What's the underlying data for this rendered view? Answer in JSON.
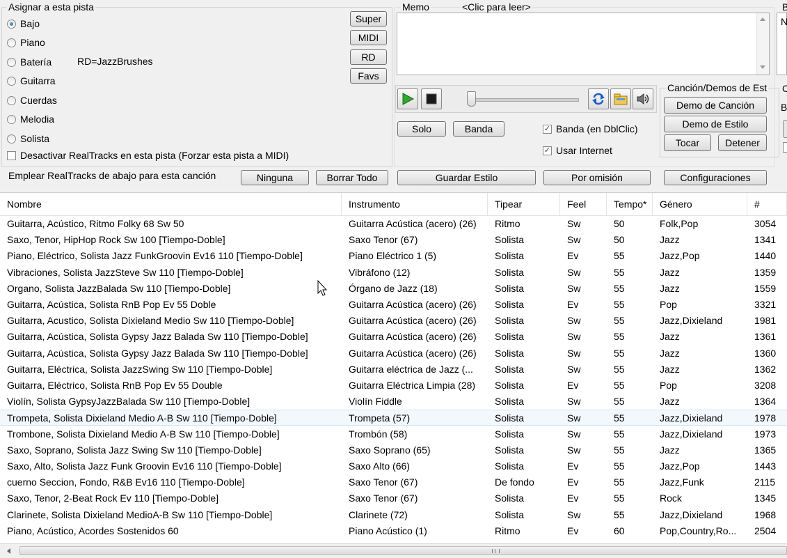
{
  "assign": {
    "title": "Asignar a esta pista",
    "radios": [
      {
        "label": "Bajo",
        "selected": true
      },
      {
        "label": "Piano",
        "selected": false
      },
      {
        "label": "Batería",
        "selected": false
      },
      {
        "label": "Guitarra",
        "selected": false
      },
      {
        "label": "Cuerdas",
        "selected": false
      },
      {
        "label": "Melodia",
        "selected": false
      },
      {
        "label": "Solista",
        "selected": false
      }
    ],
    "rd_note": "RD=JazzBrushes",
    "disable_label": "Desactivar RealTracks en esta pista (Forzar esta pista a MIDI)",
    "side_buttons": [
      "Super",
      "MIDI",
      "RD",
      "Favs"
    ]
  },
  "memo": {
    "title": "Memo",
    "hint": "<Clic para leer>"
  },
  "right_panel": {
    "title_fragment": "B",
    "memo_fragment": "N"
  },
  "player": {
    "solo": "Solo",
    "banda": "Banda",
    "check_banda": "Banda (en DblClic)",
    "check_internet": "Usar Internet"
  },
  "demos": {
    "title": "Canción/Demos de Est",
    "demo_cancion": "Demo de Canción",
    "demo_estilo": "Demo de Estilo",
    "tocar": "Tocar",
    "detener": "Detener",
    "edge_c": "C",
    "edge_b": "B"
  },
  "action_bar": {
    "label": "Emplear RealTracks de abajo para esta canción",
    "ninguna": "Ninguna",
    "borrar": "Borrar Todo",
    "guardar": "Guardar Estilo",
    "omision": "Por omisión",
    "config": "Configuraciones"
  },
  "table": {
    "columns": [
      "Nombre",
      "Instrumento",
      "Tipear",
      "Feel",
      "Tempo*",
      "Género",
      "#"
    ],
    "rows": [
      [
        "Guitarra, Acústico, Ritmo Folky 68 Sw 50",
        "Guitarra Acústica (acero) (26)",
        "Ritmo",
        "Sw",
        "50",
        "Folk,Pop",
        "3054"
      ],
      [
        "Saxo, Tenor, HipHop Rock Sw 100 [Tiempo-Doble]",
        "Saxo Tenor (67)",
        "Solista",
        "Sw",
        "50",
        "Jazz",
        "1341"
      ],
      [
        "Piano, Eléctrico, Solista Jazz FunkGroovin Ev16 110 [Tiempo-Doble]",
        "Piano Eléctrico 1 (5)",
        "Solista",
        "Ev",
        "55",
        "Jazz,Pop",
        "1440"
      ],
      [
        "Vibraciones, Solista JazzSteve Sw 110 [Tiempo-Doble]",
        "Vibráfono (12)",
        "Solista",
        "Sw",
        "55",
        "Jazz",
        "1359"
      ],
      [
        "Organo, Solista JazzBalada Sw 110 [Tiempo-Doble]",
        "Órgano de Jazz (18)",
        "Solista",
        "Sw",
        "55",
        "Jazz",
        "1559"
      ],
      [
        "Guitarra, Acústica, Solista RnB Pop Ev 55 Doble",
        "Guitarra Acústica (acero) (26)",
        "Solista",
        "Ev",
        "55",
        "Pop",
        "3321"
      ],
      [
        "Guitarra, Acustico, Solista Dixieland Medio Sw 110 [Tiempo-Doble]",
        "Guitarra Acústica (acero) (26)",
        "Solista",
        "Sw",
        "55",
        "Jazz,Dixieland",
        "1981"
      ],
      [
        "Guitarra, Acústica, Solista Gypsy Jazz Balada Sw 110 [Tiempo-Doble]",
        "Guitarra Acústica (acero) (26)",
        "Solista",
        "Sw",
        "55",
        "Jazz",
        "1361"
      ],
      [
        "Guitarra, Acústica, Solista Gypsy Jazz Balada Sw 110 [Tiempo-Doble]",
        "Guitarra Acústica (acero) (26)",
        "Solista",
        "Sw",
        "55",
        "Jazz",
        "1360"
      ],
      [
        "Guitarra, Eléctrica, Solista JazzSwing Sw 110 [Tiempo-Doble]",
        "Guitarra eléctrica de Jazz (...",
        "Solista",
        "Sw",
        "55",
        "Jazz",
        "1362"
      ],
      [
        "Guitarra, Eléctrico, Solista RnB Pop Ev 55 Double",
        "Guitarra Eléctrica Limpia (28)",
        "Solista",
        "Ev",
        "55",
        "Pop",
        "3208"
      ],
      [
        "Violín, Solista GypsyJazzBalada Sw 110 [Tiempo-Doble]",
        "Violín Fiddle",
        "Solista",
        "Sw",
        "55",
        "Jazz",
        "1364"
      ],
      [
        "Trompeta, Solista Dixieland Medio A-B Sw 110 [Tiempo-Doble]",
        "Trompeta (57)",
        "Solista",
        "Sw",
        "55",
        "Jazz,Dixieland",
        "1978"
      ],
      [
        "Trombone, Solista Dixieland Medio A-B Sw 110 [Tiempo-Doble]",
        "Trombón (58)",
        "Solista",
        "Sw",
        "55",
        "Jazz,Dixieland",
        "1973"
      ],
      [
        "Saxo, Soprano, Solista Jazz Swing Sw 110 [Tiempo-Doble]",
        "Saxo Soprano (65)",
        "Solista",
        "Sw",
        "55",
        "Jazz",
        "1365"
      ],
      [
        "Saxo, Alto, Solista Jazz Funk Groovin Ev16 110 [Tiempo-Doble]",
        "Saxo Alto (66)",
        "Solista",
        "Ev",
        "55",
        "Jazz,Pop",
        "1443"
      ],
      [
        "cuerno Seccion, Fondo, R&B Ev16 110 [Tiempo-Doble]",
        "Saxo Tenor (67)",
        "De fondo",
        "Ev",
        "55",
        "Jazz,Funk",
        "2115"
      ],
      [
        "Saxo, Tenor, 2-Beat Rock Ev 110 [Tiempo-Doble]",
        "Saxo Tenor (67)",
        "Solista",
        "Ev",
        "55",
        "Rock",
        "1345"
      ],
      [
        "Clarinete, Solista Dixieland MedioA-B Sw 110 [Tiempo-Doble]",
        "Clarinete (72)",
        "Solista",
        "Sw",
        "55",
        "Jazz,Dixieland",
        "1968"
      ],
      [
        "Piano, Acústico, Acordes Sostenidos 60",
        "Piano Acústico (1)",
        "Ritmo",
        "Ev",
        "60",
        "Pop,Country,Ro...",
        "2504"
      ]
    ],
    "selected_row_index": 12
  },
  "colors": {
    "play_green": "#2fa82f",
    "selection": "#f3f8fd"
  }
}
